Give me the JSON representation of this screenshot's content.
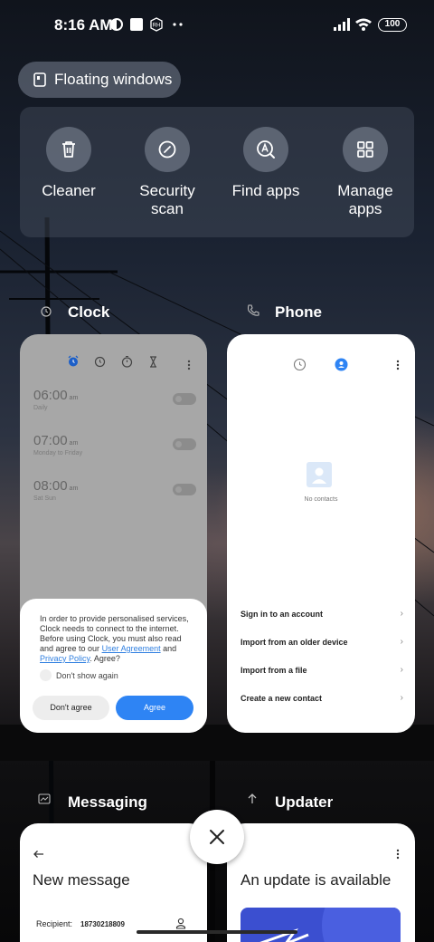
{
  "status_bar": {
    "time": "8:16 AM",
    "battery": "100",
    "icons": [
      "data-saver-icon",
      "notification-square-icon",
      "rh-icon",
      "more-dots-icon",
      "signal-icon",
      "wifi-icon",
      "battery-icon"
    ]
  },
  "floating_windows": {
    "label": "Floating windows",
    "icon": "floating-window-icon"
  },
  "quick_actions": [
    {
      "label": "Cleaner",
      "icon": "trash-icon"
    },
    {
      "label": "Security\nscan",
      "icon": "security-scan-icon"
    },
    {
      "label": "Find apps",
      "icon": "find-apps-icon"
    },
    {
      "label": "Manage\napps",
      "icon": "grid-icon"
    }
  ],
  "recent_apps": {
    "clock": {
      "title": "Clock",
      "alarms": [
        {
          "time": "06:00",
          "suffix": "am",
          "days": "Daily"
        },
        {
          "time": "07:00",
          "suffix": "am",
          "days": "Monday to Friday"
        },
        {
          "time": "08:00",
          "suffix": "am",
          "days": "Sat Sun"
        }
      ],
      "dialog": {
        "text_before": "In order to provide personalised services, Clock needs to connect to the internet. Before using Clock, you must also read and agree to our ",
        "link1": "User Agreement",
        "and": " and ",
        "link2": "Privacy Policy",
        "text_after": ". Agree?",
        "checkbox_label": "Don't show again",
        "disagree_label": "Don't agree",
        "agree_label": "Agree"
      }
    },
    "phone": {
      "title": "Phone",
      "empty_text": "No contacts",
      "actions": [
        "Sign in to an account",
        "Import from an older device",
        "Import from a file",
        "Create a new contact"
      ]
    },
    "messaging": {
      "title": "Messaging",
      "heading": "New message",
      "recipient_label": "Recipient:",
      "recipient_value": "18730218809"
    },
    "updater": {
      "title": "Updater",
      "heading": "An update is available"
    }
  },
  "colors": {
    "accent": "#2e84f4",
    "card": "#ffffff",
    "clock_dim": "#a7a7a7"
  }
}
